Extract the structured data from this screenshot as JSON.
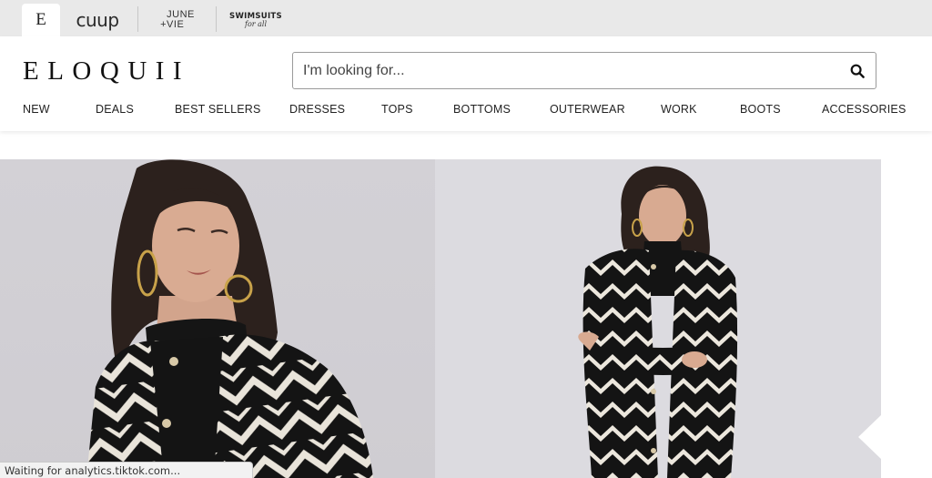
{
  "brands": {
    "eloquii_short": "E",
    "cuup": "cuup",
    "june_vie_line1": "JUNE",
    "june_vie_line2": "+VIE",
    "swimsuits_line1": "SWIMSUITS",
    "swimsuits_line2": "for all"
  },
  "header": {
    "logo": "ELOQUII",
    "search_placeholder": "I'm looking for..."
  },
  "nav": [
    "NEW",
    "DEALS",
    "BEST SELLERS",
    "DRESSES",
    "TOPS",
    "BOTTOMS",
    "OUTERWEAR",
    "WORK",
    "BOOTS",
    "ACCESSORIES"
  ],
  "status_bar": "Waiting for analytics.tiktok.com...",
  "icons": {
    "search": "search-icon",
    "carousel_prev": "chevron-left-icon"
  },
  "colors": {
    "brand_bar": "#e9e9e9",
    "text": "#222222",
    "hero_bg": "#d6d4d8"
  }
}
